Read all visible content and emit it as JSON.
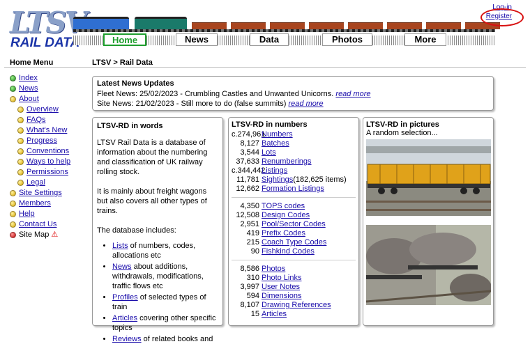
{
  "header": {
    "logo_main": "LTSV",
    "logo_sub": "RAIL DATA",
    "login_label": "Log-in",
    "register_label": "Register",
    "tabs": [
      {
        "label": "Home",
        "active": true
      },
      {
        "label": "News",
        "active": false
      },
      {
        "label": "Data",
        "active": false
      },
      {
        "label": "Photos",
        "active": false
      },
      {
        "label": "More",
        "active": false
      }
    ],
    "loco_colors": [
      "#2f6fd1",
      "#1a7a6a"
    ],
    "wagon_color": "#a8451f",
    "highlight_color": "#d81010"
  },
  "sidebar": {
    "title": "Home Menu",
    "items": [
      {
        "label": "Index",
        "dot": "green",
        "sub": false
      },
      {
        "label": "News",
        "dot": "green",
        "sub": false
      },
      {
        "label": "About",
        "dot": "yellow",
        "sub": false
      },
      {
        "label": "Overview",
        "dot": "yellow",
        "sub": true
      },
      {
        "label": "FAQs",
        "dot": "yellow",
        "sub": true
      },
      {
        "label": "What's New",
        "dot": "yellow",
        "sub": true
      },
      {
        "label": "Progress",
        "dot": "yellow",
        "sub": true
      },
      {
        "label": "Conventions",
        "dot": "yellow",
        "sub": true
      },
      {
        "label": "Ways to help",
        "dot": "yellow",
        "sub": true
      },
      {
        "label": "Permissions",
        "dot": "yellow",
        "sub": true
      },
      {
        "label": "Legal",
        "dot": "yellow",
        "sub": true
      },
      {
        "label": "Site Settings",
        "dot": "yellow",
        "sub": false
      },
      {
        "label": "Members",
        "dot": "yellow",
        "sub": false
      },
      {
        "label": "Help",
        "dot": "yellow",
        "sub": false
      },
      {
        "label": "Contact Us",
        "dot": "yellow",
        "sub": false
      },
      {
        "label": "Site Map",
        "dot": "red",
        "sub": false,
        "plain": true,
        "warn": true
      }
    ]
  },
  "breadcrumb": "LTSV > Rail Data",
  "news": {
    "title": "Latest News Updates",
    "fleet_text": "Fleet News: 25/02/2023 - Crumbling Castles and Unwanted Unicorns.",
    "site_text": "Site News: 21/02/2023 - Still more to do (false summits)",
    "read_more": "read more"
  },
  "words": {
    "title": "LTSV-RD in words",
    "p1": "LTSV Rail Data is a database of information about the numbering and classification of UK railway rolling stock.",
    "p2": "It is mainly about freight wagons but also covers all other types of trains.",
    "p3": "The database includes:",
    "list": [
      {
        "link": "Lists",
        "rest": " of numbers, codes, allocations etc"
      },
      {
        "link": "News",
        "rest": " about additions, withdrawals, modifications, traffic flows etc"
      },
      {
        "link": "Profiles",
        "rest": " of selected types of train"
      },
      {
        "link": "Articles",
        "rest": " covering other specific topics"
      },
      {
        "link": "Reviews",
        "rest": " of related books and"
      }
    ]
  },
  "numbers": {
    "title": "LTSV-RD in numbers",
    "groups": [
      [
        {
          "n": "c.274,961",
          "label": "Numbers"
        },
        {
          "n": "8,127",
          "label": "Batches"
        },
        {
          "n": "3,544",
          "label": "Lots"
        },
        {
          "n": "37,633",
          "label": "Renumberings"
        },
        {
          "n": "c.344,442",
          "label": "Listings"
        },
        {
          "n": "11,781",
          "label": "Sightings",
          "extra": " (182,625 items)"
        },
        {
          "n": "12,662",
          "label": "Formation Listings"
        }
      ],
      [
        {
          "n": "4,350",
          "label": "TOPS codes"
        },
        {
          "n": "12,508",
          "label": "Design Codes"
        },
        {
          "n": "2,951",
          "label": "Pool/Sector Codes"
        },
        {
          "n": "419",
          "label": "Prefix Codes"
        },
        {
          "n": "215",
          "label": "Coach Type Codes"
        },
        {
          "n": "90",
          "label": "Fishkind Codes"
        }
      ],
      [
        {
          "n": "8,586",
          "label": "Photos"
        },
        {
          "n": "310",
          "label": "Photo Links"
        },
        {
          "n": "3,997",
          "label": "User Notes"
        },
        {
          "n": "594",
          "label": "Dimensions"
        },
        {
          "n": "8,107",
          "label": "Drawing References"
        },
        {
          "n": "15",
          "label": "Articles"
        }
      ]
    ]
  },
  "pictures": {
    "title": "LTSV-RD in pictures",
    "subtitle": "A random selection..."
  }
}
